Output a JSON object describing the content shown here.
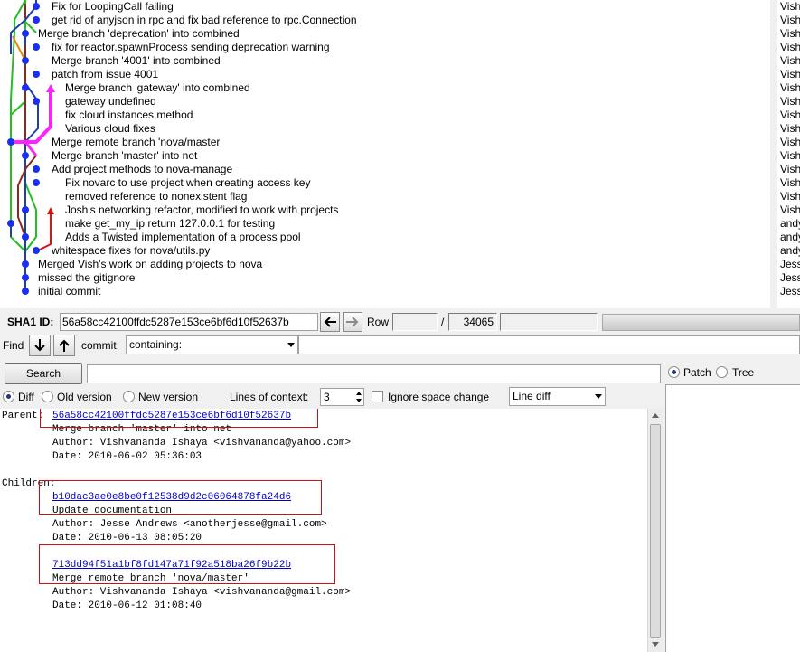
{
  "history": {
    "commits": [
      {
        "subject": "Fix for LoopingCall failing",
        "author": "Vish"
      },
      {
        "subject": "get rid of anyjson in rpc and fix bad reference to rpc.Connection",
        "author": "Vish"
      },
      {
        "subject": "Merge branch 'deprecation' into combined",
        "author": "Vish"
      },
      {
        "subject": "fix for reactor.spawnProcess sending deprecation warning",
        "author": "Vish"
      },
      {
        "subject": "Merge branch '4001' into combined",
        "author": "Vish"
      },
      {
        "subject": "patch from issue 4001",
        "author": "Vish"
      },
      {
        "subject": "Merge branch 'gateway' into combined",
        "author": "Vish"
      },
      {
        "subject": "gateway undefined",
        "author": "Vish"
      },
      {
        "subject": "fix cloud instances method",
        "author": "Vish"
      },
      {
        "subject": "Various cloud fixes",
        "author": "Vish"
      },
      {
        "subject": "Merge remote branch 'nova/master'",
        "author": "Vish"
      },
      {
        "subject": "Merge branch 'master' into net",
        "author": "Vish"
      },
      {
        "subject": "Add project methods to nova-manage",
        "author": "Vish"
      },
      {
        "subject": "Fix novarc to use project when creating access key",
        "author": "Vish"
      },
      {
        "subject": "removed reference to nonexistent flag",
        "author": "Vish"
      },
      {
        "subject": "Josh's networking refactor, modified to work with projects",
        "author": "Vish"
      },
      {
        "subject": "make get_my_ip return 127.0.0.1 for testing",
        "author": "andy"
      },
      {
        "subject": "Adds a Twisted implementation of a process pool",
        "author": "andy"
      },
      {
        "subject": "whitespace fixes for nova/utils.py",
        "author": "andy"
      },
      {
        "subject": "Merged Vish's work on adding projects to nova",
        "author": "Jess"
      },
      {
        "subject": "missed the gitignore",
        "author": "Jess"
      },
      {
        "subject": "initial commit",
        "author": "Jess"
      }
    ]
  },
  "sha_bar": {
    "label": "SHA1 ID:",
    "sha": "56a58cc42100ffdc5287e153ce6bf6d10f52637b",
    "row_label": "Row",
    "row_value": "",
    "separator": "/",
    "row_total": "34065",
    "extra_value": ""
  },
  "find_bar": {
    "find_label": "Find",
    "commit_label": "commit",
    "mode": "containing:",
    "query": ""
  },
  "search": {
    "button_label": "Search",
    "query": ""
  },
  "view_options": {
    "radios": [
      {
        "label": "Diff",
        "checked": true
      },
      {
        "label": "Old version",
        "checked": false
      },
      {
        "label": "New version",
        "checked": false
      }
    ],
    "context_label": "Lines of context:",
    "context_value": "3",
    "ignore_space_label": "Ignore space change",
    "diff_mode": "Line diff"
  },
  "file_view": {
    "patch_label": "Patch",
    "tree_label": "Tree",
    "selected": "Patch"
  },
  "details": {
    "parent_label": "Parent:",
    "parent": {
      "sha": "56a58cc42100ffdc5287e153ce6bf6d10f52637b",
      "subject": "Merge branch 'master' into net",
      "author": "Author: Vishvananda Ishaya <vishvananda@yahoo.com>",
      "date": "Date:   2010-06-02 05:36:03"
    },
    "children_label": "Children:",
    "children": [
      {
        "sha": "b10dac3ae0e8be0f12538d9d2c06064878fa24d6",
        "subject": "Update documentation",
        "author": "Author: Jesse Andrews <anotherjesse@gmail.com>",
        "date": "Date:   2010-06-13 08:05:20"
      },
      {
        "sha": "713dd94f51a1bf8fd147a71f92a518ba26f9b22b",
        "subject": "Merge remote branch 'nova/master'",
        "author": "Author: Vishvananda Ishaya <vishvananda@gmail.com>",
        "date": "Date:   2010-06-12 01:08:40"
      }
    ]
  },
  "colors": {
    "graph_blue": "#1e3fa6",
    "graph_green": "#22c022",
    "graph_brown": "#8b2a1a",
    "graph_magenta": "#ff22ff",
    "graph_red": "#e01010",
    "graph_orange": "#e08a00",
    "graph_node": "#1a2ff0",
    "link": "#0000cc",
    "highlight_box": "#d01010"
  }
}
